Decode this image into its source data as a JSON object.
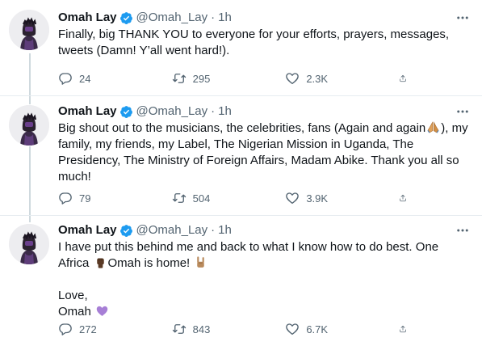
{
  "tweets": [
    {
      "name": "Omah Lay",
      "handle": "@Omah_Lay",
      "separator": "·",
      "time": "1h",
      "lines": [
        "Finally, big THANK YOU to everyone for your efforts, prayers, messages,",
        "tweets (Damn! Y’all went hard!)."
      ],
      "replies": "24",
      "retweets": "295",
      "likes": "2.3K"
    },
    {
      "name": "Omah Lay",
      "handle": "@Omah_Lay",
      "separator": "·",
      "time": "1h",
      "line1_a": "Big shout out to the musicians, the celebrities, fans (Again and again",
      "line1_b": "), my",
      "line2": "family, my friends, my Label, The Nigerian Mission in Uganda, The",
      "line3": "Presidency, The Ministry of Foreign Affairs, Madam Abike. Thank you all so",
      "line4": "much!",
      "replies": "79",
      "retweets": "504",
      "likes": "3.9K"
    },
    {
      "name": "Omah Lay",
      "handle": "@Omah_Lay",
      "separator": "·",
      "time": "1h",
      "line1": "I have put this behind me and back to what I know how to do best. One",
      "line2_a": "Africa",
      "line2_b": "Omah is home!",
      "line3": "Love,",
      "line4": "Omah",
      "replies": "272",
      "retweets": "843",
      "likes": "6.7K"
    }
  ],
  "icons": {
    "verified": "verified-badge-icon",
    "more": "more-icon",
    "reply": "reply-icon",
    "retweet": "retweet-icon",
    "like": "like-icon",
    "share": "share-icon",
    "praying_hands": "praying-hands-emoji",
    "raised_fist": "raised-fist-emoji",
    "horns": "sign-of-the-horns-emoji",
    "purple_heart": "purple-heart-emoji"
  },
  "colors": {
    "verified_blue": "#1d9bf0",
    "text": "#0f1419",
    "secondary": "#536471",
    "thread_line": "#cfd9de",
    "purple_heart": "#a77fd6"
  }
}
